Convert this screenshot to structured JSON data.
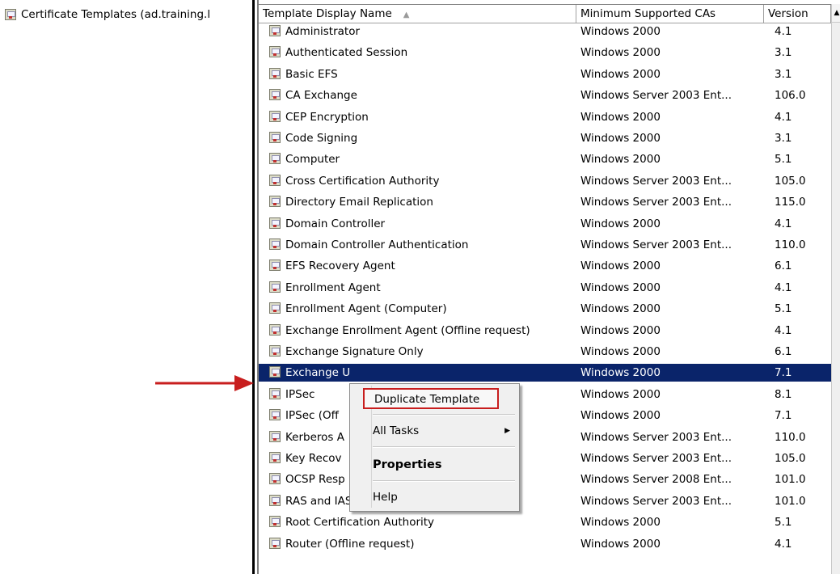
{
  "tree": {
    "root_label": "Certificate Templates (ad.training.l"
  },
  "columns": {
    "name": "Template Display Name",
    "ca": "Minimum Supported CAs",
    "version": "Version"
  },
  "rows": [
    {
      "name": "Administrator",
      "ca": "Windows 2000",
      "version": "4.1"
    },
    {
      "name": "Authenticated Session",
      "ca": "Windows 2000",
      "version": "3.1"
    },
    {
      "name": "Basic EFS",
      "ca": "Windows 2000",
      "version": "3.1"
    },
    {
      "name": "CA Exchange",
      "ca": "Windows Server 2003 Ent...",
      "version": "106.0"
    },
    {
      "name": "CEP Encryption",
      "ca": "Windows 2000",
      "version": "4.1"
    },
    {
      "name": "Code Signing",
      "ca": "Windows 2000",
      "version": "3.1"
    },
    {
      "name": "Computer",
      "ca": "Windows 2000",
      "version": "5.1"
    },
    {
      "name": "Cross Certification Authority",
      "ca": "Windows Server 2003 Ent...",
      "version": "105.0"
    },
    {
      "name": "Directory Email Replication",
      "ca": "Windows Server 2003 Ent...",
      "version": "115.0"
    },
    {
      "name": "Domain Controller",
      "ca": "Windows 2000",
      "version": "4.1"
    },
    {
      "name": "Domain Controller Authentication",
      "ca": "Windows Server 2003 Ent...",
      "version": "110.0"
    },
    {
      "name": "EFS Recovery Agent",
      "ca": "Windows 2000",
      "version": "6.1"
    },
    {
      "name": "Enrollment Agent",
      "ca": "Windows 2000",
      "version": "4.1"
    },
    {
      "name": "Enrollment Agent (Computer)",
      "ca": "Windows 2000",
      "version": "5.1"
    },
    {
      "name": "Exchange Enrollment Agent (Offline request)",
      "ca": "Windows 2000",
      "version": "4.1"
    },
    {
      "name": "Exchange Signature Only",
      "ca": "Windows 2000",
      "version": "6.1"
    },
    {
      "name": "Exchange U",
      "ca": "Windows 2000",
      "version": "7.1",
      "selected": true
    },
    {
      "name": "IPSec",
      "ca": "Windows 2000",
      "version": "8.1"
    },
    {
      "name": "IPSec (Off",
      "ca": "Windows 2000",
      "version": "7.1"
    },
    {
      "name": "Kerberos A",
      "ca": "Windows Server 2003 Ent...",
      "version": "110.0"
    },
    {
      "name": "Key Recov",
      "ca": "Windows Server 2003 Ent...",
      "version": "105.0"
    },
    {
      "name": "OCSP Resp",
      "ca": "Windows Server 2008 Ent...",
      "version": "101.0"
    },
    {
      "name": "RAS and IAS Server",
      "ca": "Windows Server 2003 Ent...",
      "version": "101.0"
    },
    {
      "name": "Root Certification Authority",
      "ca": "Windows 2000",
      "version": "5.1"
    },
    {
      "name": "Router (Offline request)",
      "ca": "Windows 2000",
      "version": "4.1"
    }
  ],
  "context_menu": {
    "duplicate": "Duplicate Template",
    "all_tasks": "All Tasks",
    "properties": "Properties",
    "help": "Help"
  },
  "colors": {
    "selection": "#0a246a",
    "highlight_box": "#c81e1e",
    "annotation_arrow": "#c81e1e"
  }
}
